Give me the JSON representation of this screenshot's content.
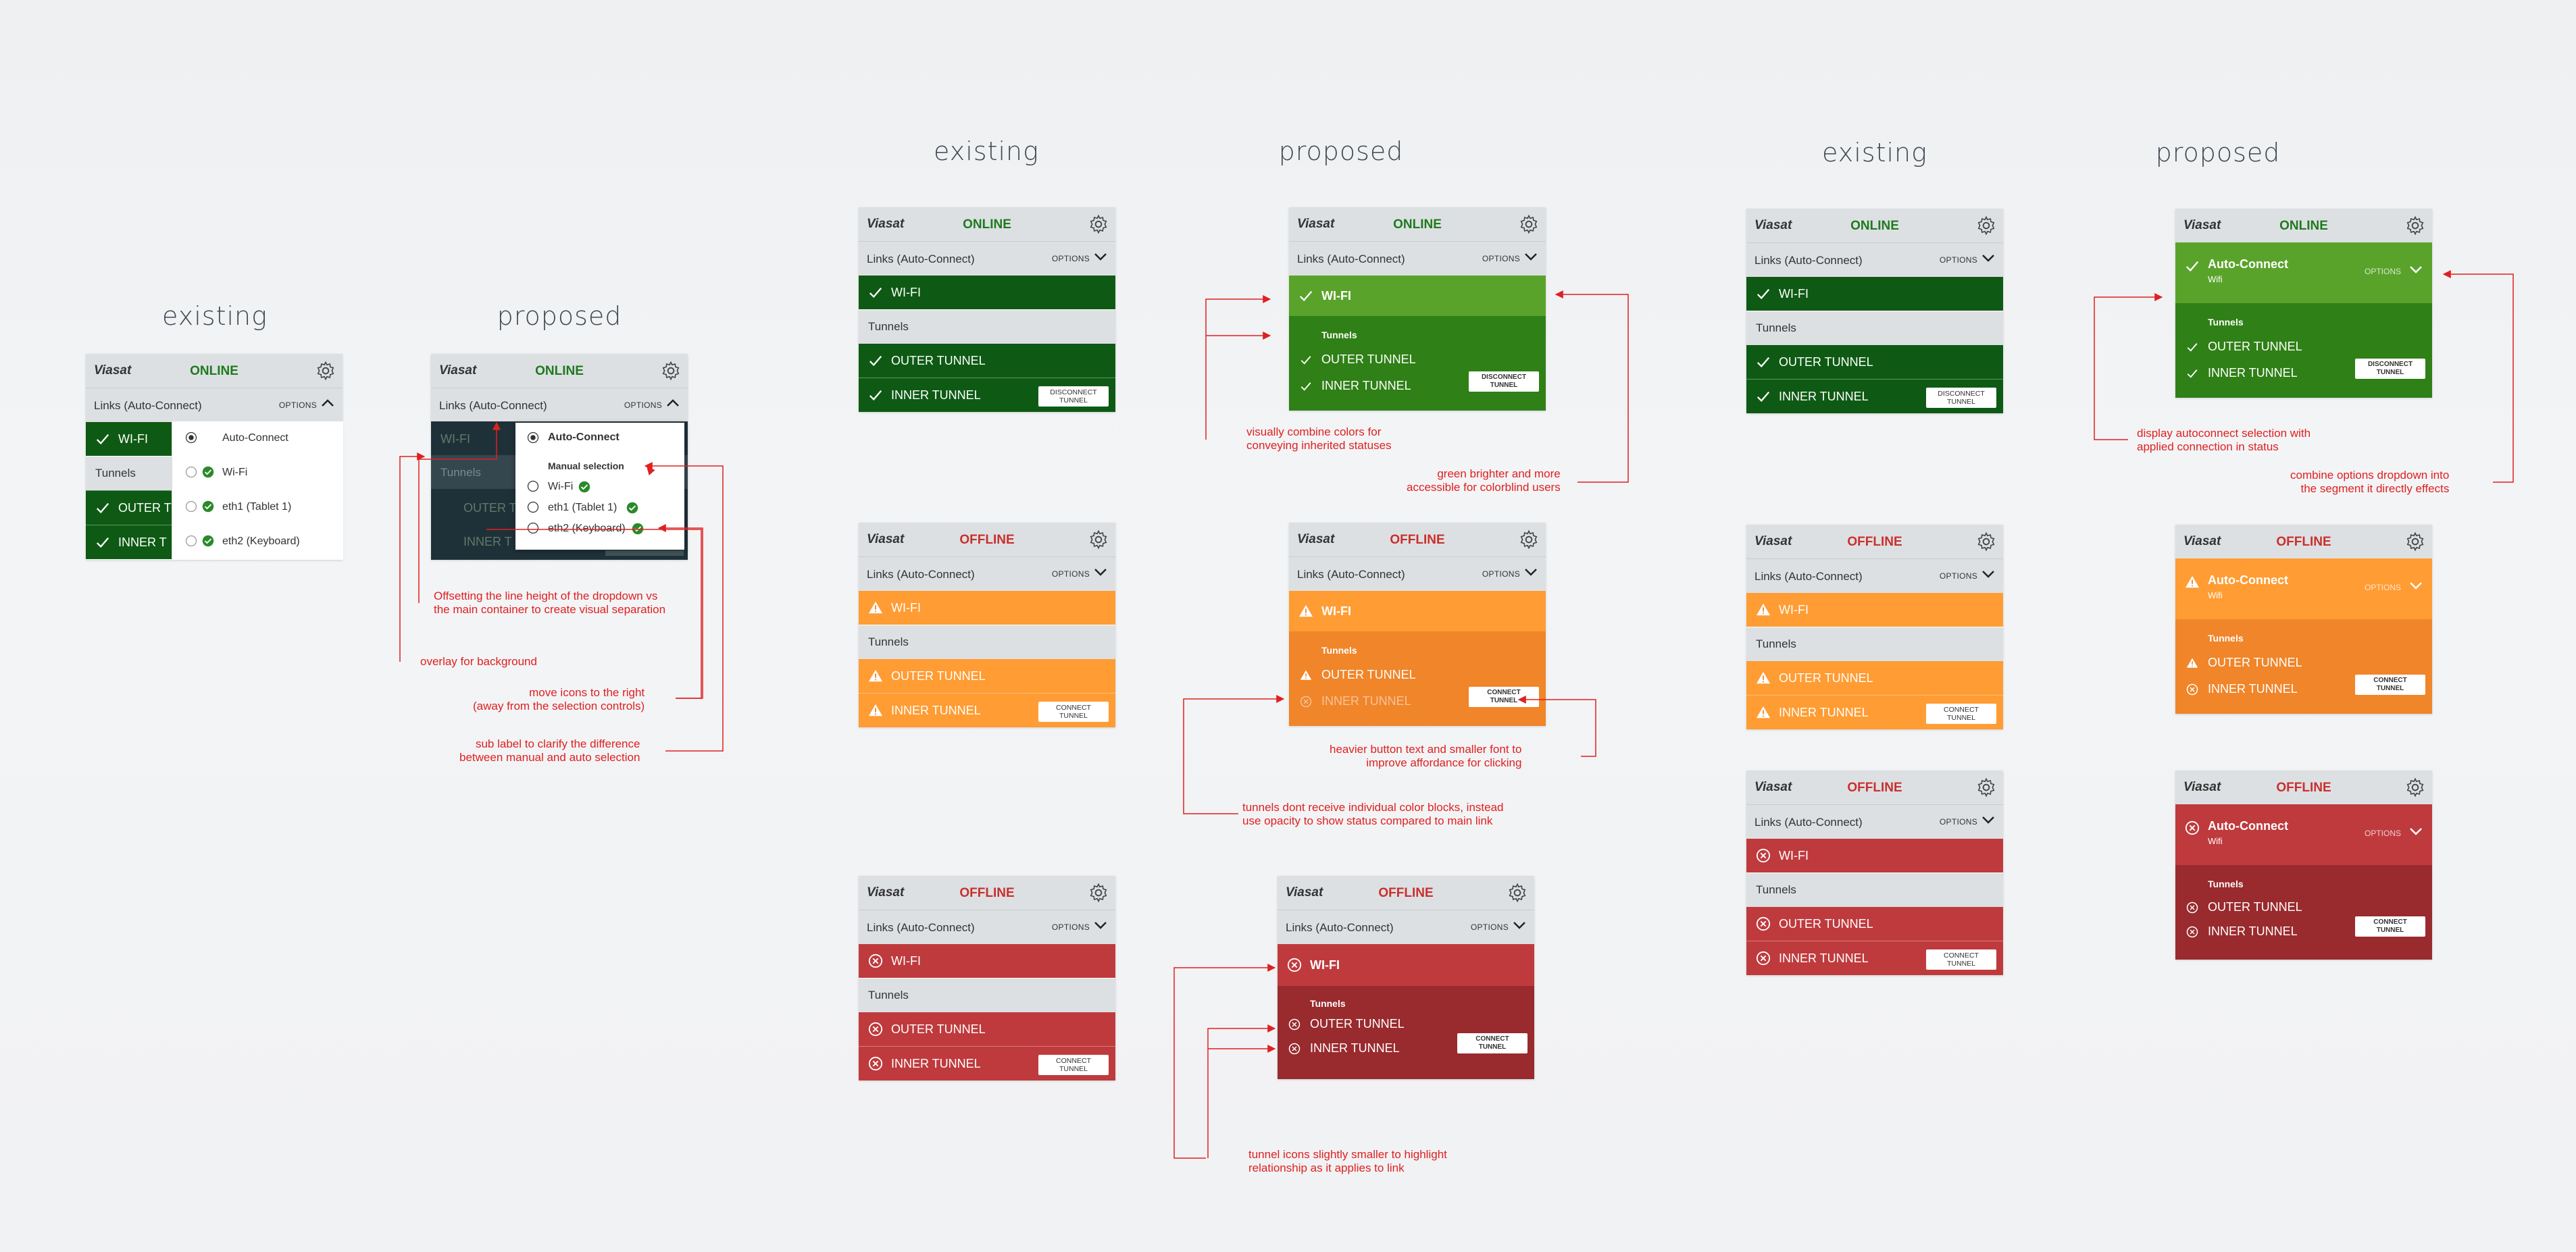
{
  "headings": {
    "g1_existing": "existing",
    "g1_proposed": "proposed",
    "g2_existing": "existing",
    "g2_proposed": "proposed",
    "g3_existing": "existing",
    "g3_proposed": "proposed"
  },
  "common": {
    "logo": "Viasat",
    "links_label": "Links (Auto-Connect)",
    "options_label": "OPTIONS",
    "tunnels_label": "Tunnels",
    "wifi": "WI-FI",
    "outer": "OUTER TUNNEL",
    "inner": "INNER TUNNEL",
    "online": "ONLINE",
    "offline": "OFFLINE",
    "disconnect": "DISCONNECT TUNNEL",
    "connect": "CONNECT TUNNEL",
    "auto_connect": "Auto-Connect",
    "wifi_sub": "Wifi",
    "outer_short": "OUTER T",
    "inner_short": "INNER T"
  },
  "dropdown": {
    "auto_connect": "Auto-Connect",
    "manual_selection": "Manual selection",
    "wifi": "Wi-Fi",
    "eth1": "eth1 (Tablet 1)",
    "eth2": "eth2 (Keyboard)"
  },
  "notes": {
    "n1": "Offsetting the line height of the dropdown vs",
    "n1b": "the main container to create visual separation",
    "n2": "overlay for background",
    "n3": "move icons to the right",
    "n3b": "(away from the selection controls)",
    "n4": "sub label to clarify the difference",
    "n4b": "between manual and auto selection",
    "n5": "visually combine colors for",
    "n5b": "conveying inherited statuses",
    "n6": "green brighter and more",
    "n6b": "accessible for colorblind users",
    "n7": "heavier button text and smaller font to",
    "n7b": "improve affordance for clicking",
    "n8": "tunnels dont receive individual color blocks, instead",
    "n8b": "use opacity to show status compared to main link",
    "n9": "tunnel icons slightly smaller to highlight",
    "n9b": "relationship as it applies to link",
    "n10": "display autoconnect selection with",
    "n10b": "applied connection in status",
    "n11": "combine options dropdown into",
    "n11b": "the segment it directly effects"
  },
  "colors": {
    "online_text": "#1e7a1e",
    "offline_text": "#c9302c",
    "green_dark": "#0e5a14",
    "green_light": "#5aa32b",
    "orange": "#ff9c33",
    "red": "#bf3a3d",
    "annotation": "#e02020"
  },
  "icons": [
    "check-icon",
    "warning-icon",
    "x-circle-icon",
    "gear-icon",
    "chevron-down-icon",
    "chevron-up-icon",
    "radio-icon",
    "check-badge-icon"
  ]
}
